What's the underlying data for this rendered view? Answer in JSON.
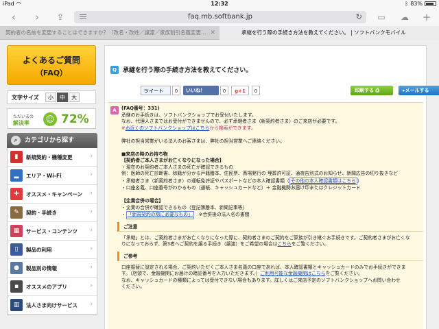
{
  "statusbar": {
    "device": "iPad",
    "time": "12:32",
    "battery": "83%",
    "battery_level": 0.83
  },
  "browser": {
    "url": "faq.mb.softbank.jp",
    "tabs": [
      {
        "label": "契約者の名前を変更することはできますか？（改名・改姓／譲渡／家族割引名義変更…"
      },
      {
        "label": "承継を行う際の手続き方法を教えてください。 | ソフトバンクモバイル"
      }
    ]
  },
  "sidebar": {
    "faq_line1": "よくあるご質問",
    "faq_line2": "（FAQ）",
    "fontsize_label": "文字サイズ",
    "fontsize_options": [
      "小",
      "中",
      "大"
    ],
    "solve_label1": "ただいまの",
    "solve_label2": "解決率",
    "solve_rate": "72%",
    "category_header": "カテゴリから探す",
    "categories": [
      {
        "label": "新規契約・機種変更",
        "icon": "phone-icon",
        "color": "#d23030"
      },
      {
        "label": "エリア・Wi-Fi",
        "icon": "signal-icon",
        "color": "#3070c0"
      },
      {
        "label": "オススメ・キャンペーン",
        "icon": "gift-icon",
        "color": "#e03a3a"
      },
      {
        "label": "契約・手続き",
        "icon": "pen-icon",
        "color": "#8a6a40"
      },
      {
        "label": "サービス・コンテンツ",
        "icon": "services-icon",
        "color": "#d0405a"
      },
      {
        "label": "製品の利用",
        "icon": "device-icon",
        "color": "#3a5a9a"
      },
      {
        "label": "製品別の情報",
        "icon": "person-icon",
        "color": "#5a7aa0"
      },
      {
        "label": "オススメのアプリ",
        "icon": "apps-icon",
        "color": "#4a4a4a"
      },
      {
        "label": "法人さま向けサービス",
        "icon": "building-icon",
        "color": "#2a4a7a"
      }
    ]
  },
  "question": {
    "badge": "Q",
    "title": "承継を行う際の手続き方法を教えてください。"
  },
  "share": {
    "tweet": "ツイート",
    "tweet_count": "0",
    "like": "いいね！",
    "like_count": "0",
    "gplus": "g+1",
    "gplus_count": "0",
    "print": "印刷する",
    "mail": "メールする"
  },
  "answer": {
    "badge": "A",
    "faq_no": "(FAQ番号：331)",
    "l1": "承継のお手続きは、ソフトバンクショップでお受付いたします。",
    "l2": "なお、代理人さまではお受付ができませんので、必ず承継者さま（新契約者さま）のご来店が必要です。",
    "l3_prefix": "※",
    "l3_link": "お近くのソフトバンクショップはこちら",
    "l3_suffix": "から検索ができます。",
    "l4": "弊社の担当営業がいる法人のお客さまは、弊社の担当営業へご連絡ください。",
    "h_items": "■来店の時のお持ち物",
    "h_individual": "【契約者ご本人さまがお亡くなりになった場合】",
    "i1": "・現在のお契約者ご本人さまの死亡が確認できるもの",
    "i2": "例：医師の死亡診断書、除籍が分かる戸籍謄本、住民票、斎場発行の 埋葬許可証、通夜告別式のお知らせ、新聞広告の切り抜きなど",
    "i3_prefix": "・承継者さま（新契約者さま）の運転免許証やパスポートなどの本人確認書類（",
    "i3_link": "その他の本人確認書類はこちら",
    "i3_suffix": "）",
    "i4": "・口座名義、口座番号がわかるもの（通帳、キャッシュカードなど）＋ 金融機関お届け印またはクレジットカード",
    "h_corp": "【企業合併の場合】",
    "c1": "・企業の合併が確認できるもの（登記簿謄本、新聞記事等）",
    "c2_prefix": "・",
    "c2_link": "「新規契約の際に必要なもの」",
    "c2_suffix": "　※合併後の法人名の書類",
    "note_title": "ご注意",
    "n1": "「承継」とは、ご契約者さまがお亡くなりになった際に、契約者さまのご契約をご家族が引き継ぐお手続きです。ご契約者さまがお亡くな",
    "n2_prefix": "りになっておらず、第3者へご契約を譲る手続き（譲渡）をご希望の場合は",
    "n2_link": "こちら",
    "n2_suffix": "をご覧ください。",
    "ref_title": "ご参考",
    "r1": "口座振替に設定される場合、ご契約いただくご本人さま名義の口座であれば、本人確認書類とキャッシュカードのみでお手続きができま",
    "r2_prefix": "す。（店頭で、金融機関にお届けの暗証番号を入力いただきます。）",
    "r2_link": "ご利用可能な金融機関はこちら",
    "r2_suffix": "をご覧ください。",
    "r3": "なお、キャッシュカードの種類によっては受付できない場合もあります。詳しくはご来店予定のソフトバンクショップへお問い合わせ",
    "r4": "ください。"
  }
}
